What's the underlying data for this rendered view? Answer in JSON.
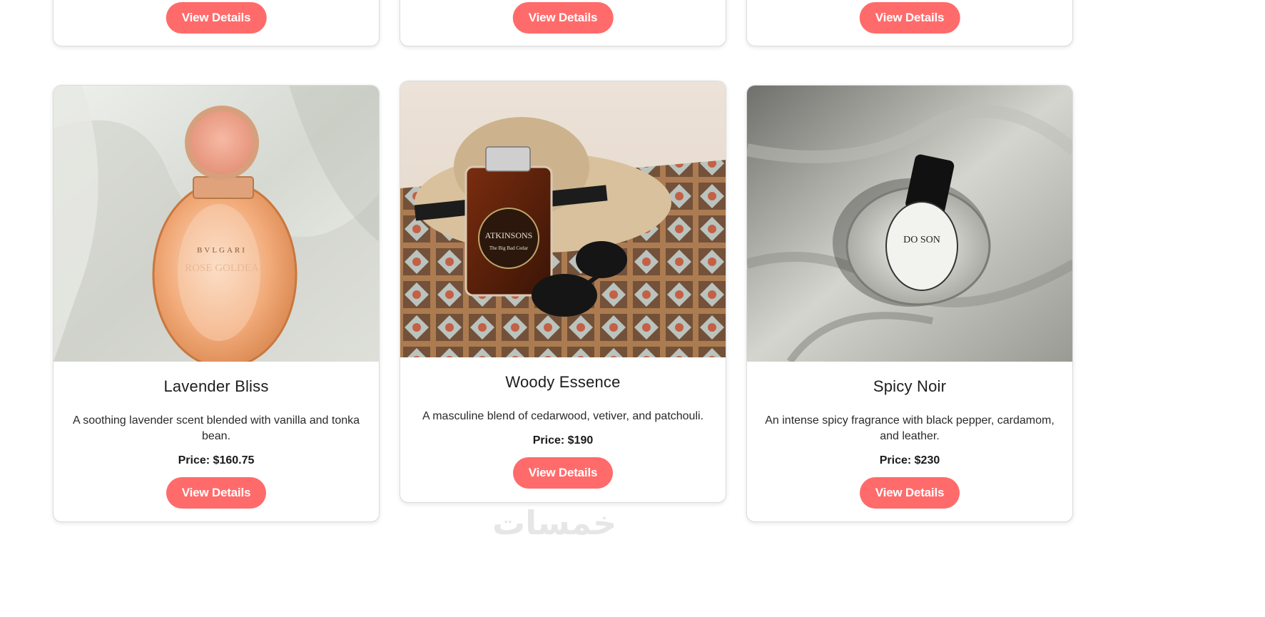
{
  "top_row": [
    {
      "button_label": "View Details"
    },
    {
      "button_label": "View Details"
    },
    {
      "button_label": "View Details"
    }
  ],
  "products": [
    {
      "name": "Lavender Bliss",
      "description": "A soothing lavender scent blended with vanilla and tonka bean.",
      "price": "Price: $160.75",
      "button_label": "View Details",
      "bottle_brand": "BVLGARI",
      "bottle_label": "ROSE GOLDEA"
    },
    {
      "name": "Woody Essence",
      "description": "A masculine blend of cedarwood, vetiver, and patchouli.",
      "price": "Price: $190",
      "button_label": "View Details",
      "bottle_brand": "ATKINSONS",
      "bottle_label": "The Big Bad Cedar"
    },
    {
      "name": "Spicy Noir",
      "description": "An intense spicy fragrance with black pepper, cardamom, and leather.",
      "price": "Price: $230",
      "button_label": "View Details",
      "bottle_brand": "DO SON"
    }
  ],
  "watermark": "خمسات",
  "colors": {
    "button": "#ff6b6b",
    "card_border": "#dcdcdc"
  }
}
